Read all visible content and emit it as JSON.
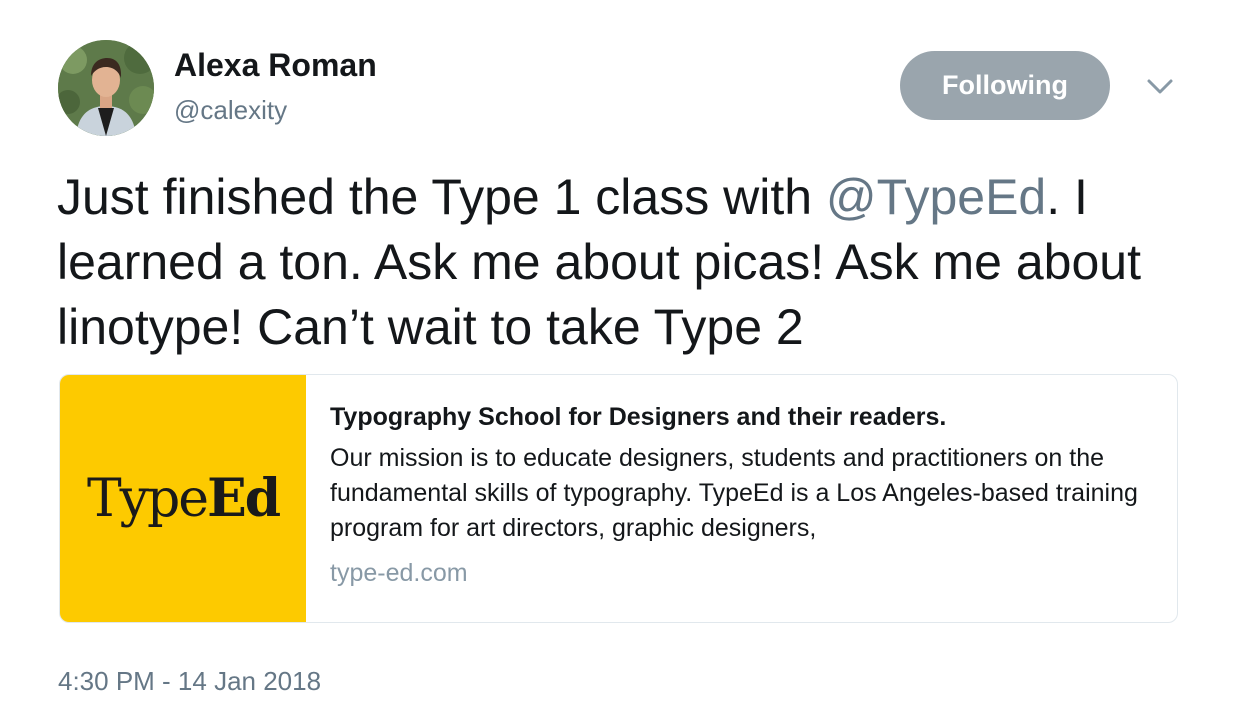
{
  "author": {
    "display_name": "Alexa Roman",
    "handle": "@calexity",
    "avatar_icon": "profile-photo"
  },
  "actions": {
    "follow_label": "Following",
    "caret_icon": "chevron-down-icon"
  },
  "tweet": {
    "text_before": "Just finished the Type 1 class with ",
    "mention": "@TypeEd",
    "text_after": ". I learned a ton. Ask me about picas! Ask me about linotype! Can’t wait to take Type 2"
  },
  "card": {
    "logo_light": "Type",
    "logo_bold": "Ed",
    "title": "Typography School for Designers and their readers.",
    "description": "Our mission is to educate designers, students and practitioners on the fundamental skills of typography. TypeEd is a Los Angeles-based training program for art directors, graphic designers,",
    "url": "type-ed.com",
    "image_color": "#fdca00"
  },
  "timestamp": "4:30 PM - 14 Jan 2018",
  "colors": {
    "follow_button_bg": "#9aa5ad",
    "secondary_text": "#657786",
    "primary_text": "#14171a"
  }
}
